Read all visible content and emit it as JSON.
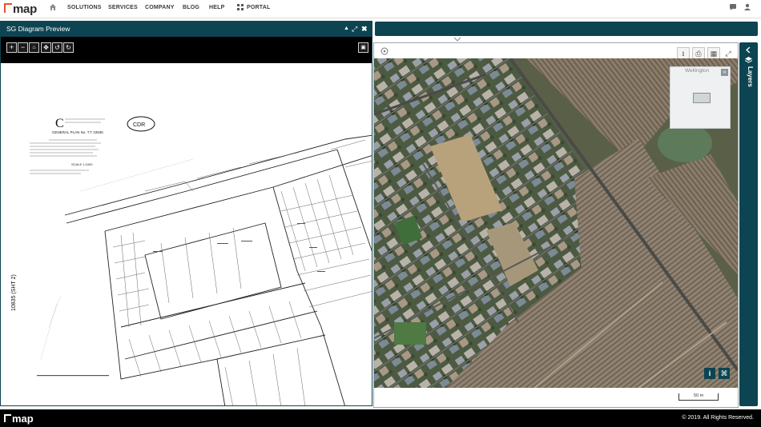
{
  "brand": {
    "logo_text": "map",
    "accent": "#e8542a",
    "dark": "#0d4452"
  },
  "nav": {
    "home_icon": "home-icon",
    "items": [
      "SOLUTIONS",
      "SERVICES",
      "COMPANY",
      "BLOG",
      "HELP"
    ],
    "portal_label": "PORTAL",
    "portal_icon": "grid-icon",
    "chat_icon": "chat-icon",
    "user_icon": "user-icon"
  },
  "sg_panel": {
    "title": "SG Diagram Preview",
    "controls": [
      "collapse-icon",
      "expand-icon",
      "close-icon"
    ],
    "toolbar": [
      "zoom-in-icon",
      "zoom-out-icon",
      "home-icon",
      "pan-icon",
      "rotate-left-icon",
      "rotate-right-icon"
    ],
    "image_icon": "image-icon",
    "diagram": {
      "letter": "C",
      "cdr": "CDR",
      "plan_title": "GENERAL PLAN No. T.T 10835",
      "scale": "SCALE 1:1000",
      "side_label": "10835 (SHT 2)"
    }
  },
  "map": {
    "tools": [
      "download-icon",
      "print-icon",
      "grid-icon",
      "fullscreen-icon"
    ],
    "left_tool_icon": "target-icon",
    "overview_label": "Wellington",
    "scale_label": "50 m",
    "bottom_icons": [
      "info-icon",
      "attribution-icon"
    ]
  },
  "layers": {
    "label": "Layers"
  },
  "footer": {
    "logo_text": "map",
    "copyright": "© 2019. All Rights Reserved."
  }
}
